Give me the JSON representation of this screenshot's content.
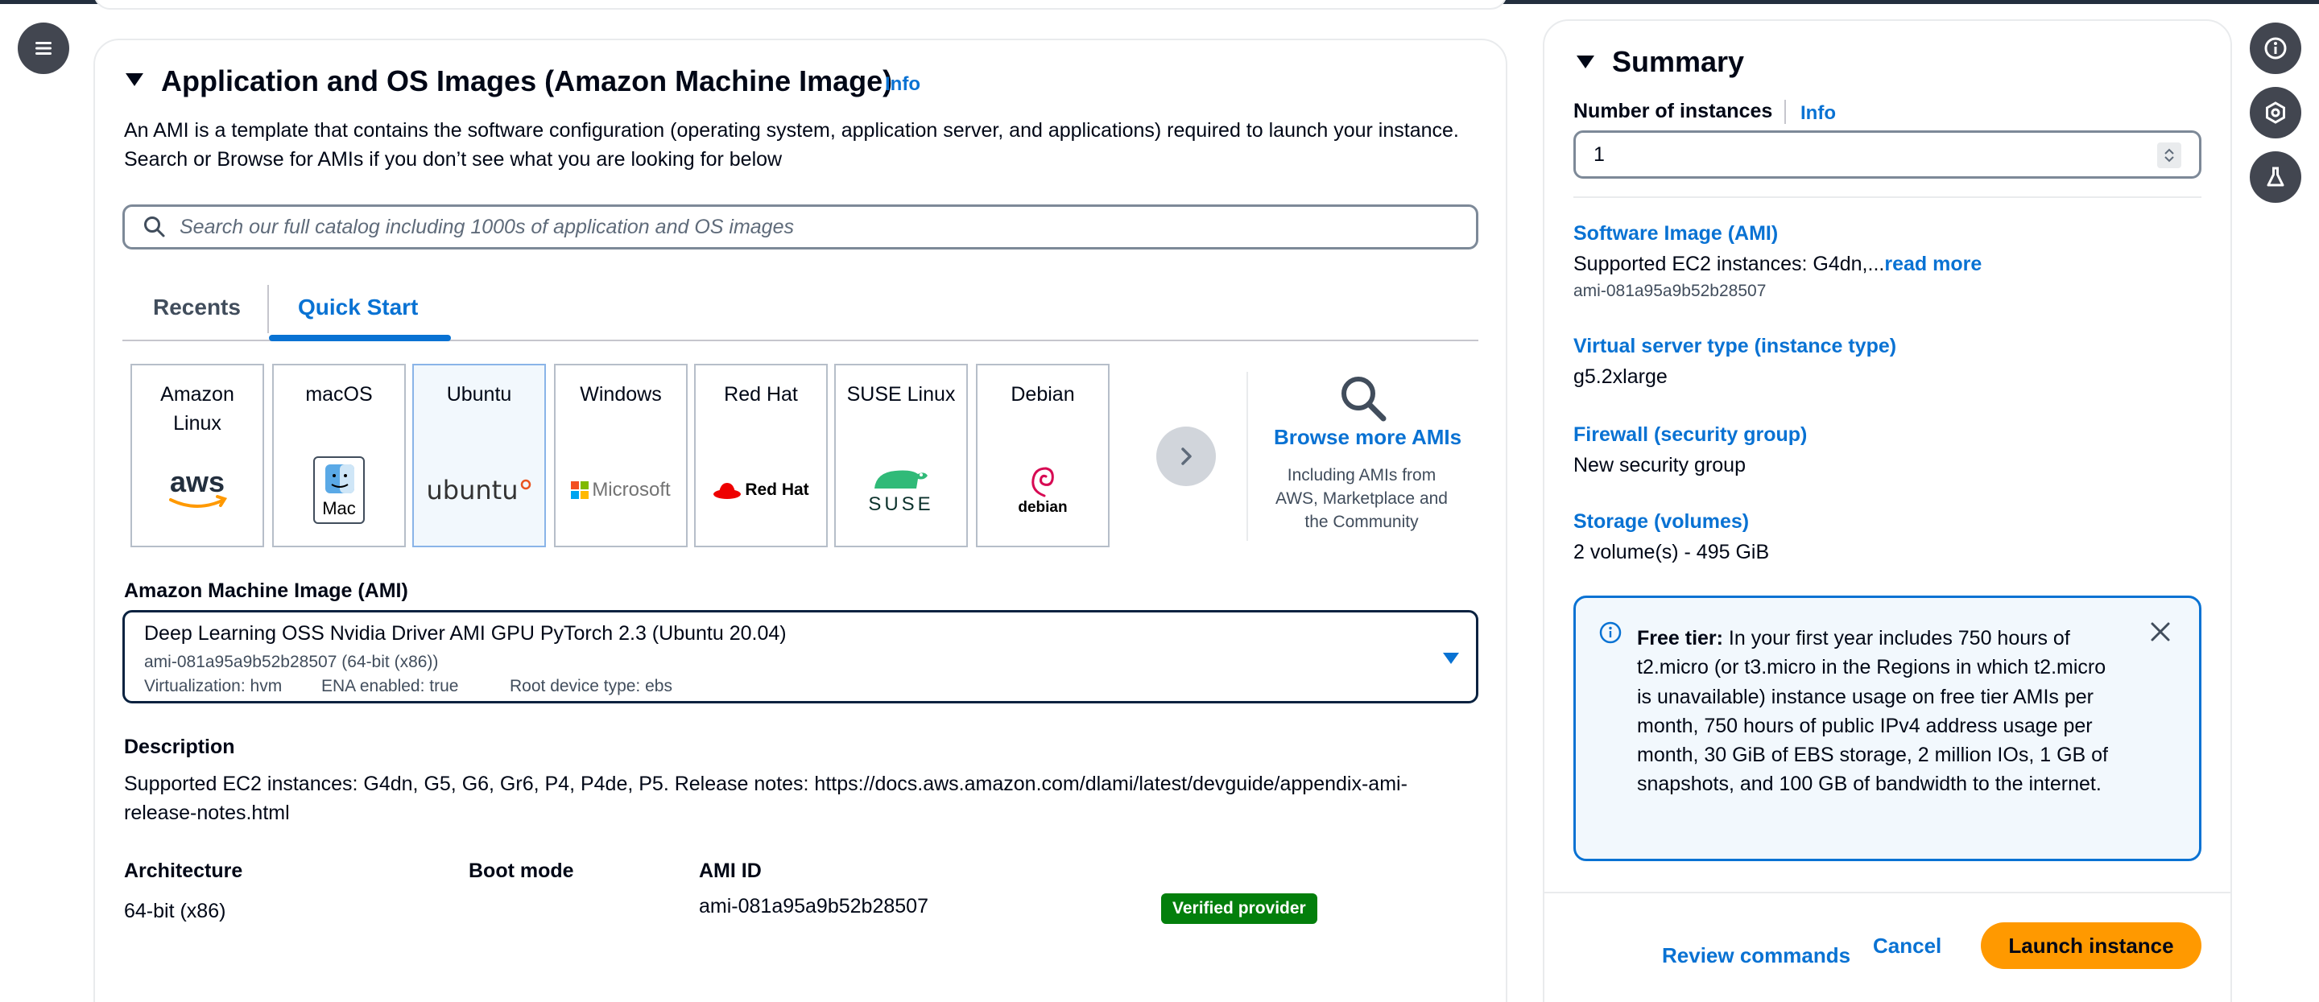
{
  "left_section": {
    "title": "Application and OS Images (Amazon Machine Image)",
    "info": "Info",
    "description": "An AMI is a template that contains the software configuration (operating system, application server, and applications) required to launch your instance. Search or Browse for AMIs if you don’t see what you are looking for below",
    "search_placeholder": "Search our full catalog including 1000s of application and OS images",
    "tabs": [
      {
        "label": "Recents",
        "active": false
      },
      {
        "label": "Quick Start",
        "active": true
      }
    ],
    "os_tiles": [
      {
        "name": "Amazon Linux",
        "logo": "aws-logo"
      },
      {
        "name": "macOS",
        "logo": "mac-finder-logo",
        "logo_text": "Mac"
      },
      {
        "name": "Ubuntu",
        "logo": "ubuntu-logo",
        "logo_text": "ubuntu",
        "selected": true
      },
      {
        "name": "Windows",
        "logo": "microsoft-logo",
        "logo_text": "Microsoft"
      },
      {
        "name": "Red Hat",
        "logo": "redhat-logo",
        "logo_text": "Red Hat"
      },
      {
        "name": "SUSE Linux",
        "logo": "suse-logo",
        "logo_text": "SUSE"
      },
      {
        "name": "Debian",
        "logo": "debian-logo",
        "logo_text": "debian"
      }
    ],
    "browse_more": {
      "label": "Browse more AMIs",
      "subtext": "Including AMIs from AWS, Marketplace and the Community"
    },
    "ami_label": "Amazon Machine Image (AMI)",
    "ami_selected": {
      "name": "Deep Learning OSS Nvidia Driver AMI GPU PyTorch 2.3 (Ubuntu 20.04)",
      "id_line": "ami-081a95a9b52b28507 (64-bit (x86))",
      "virtualization": "Virtualization: hvm",
      "ena": "ENA enabled: true",
      "root_device": "Root device type: ebs"
    },
    "description_label": "Description",
    "description_text": "Supported EC2 instances: G4dn, G5, G6, Gr6, P4, P4de, P5. Release notes: https://docs.aws.amazon.com/dlami/latest/devguide/appendix-ami-release-notes.html",
    "architecture_label": "Architecture",
    "architecture_value": "64-bit (x86)",
    "boot_mode_label": "Boot mode",
    "ami_id_label": "AMI ID",
    "ami_id_value": "ami-081a95a9b52b28507",
    "verified_badge": "Verified provider"
  },
  "summary": {
    "title": "Summary",
    "num_instances_label": "Number of instances",
    "info": "Info",
    "num_instances_value": "1",
    "software_image_label": "Software Image (AMI)",
    "software_image_value": "Supported EC2 instances: G4dn,...",
    "read_more": "read more",
    "software_image_id": "ami-081a95a9b52b28507",
    "instance_type_label": "Virtual server type (instance type)",
    "instance_type_value": "g5.2xlarge",
    "firewall_label": "Firewall (security group)",
    "firewall_value": "New security group",
    "storage_label": "Storage (volumes)",
    "storage_value": "2 volume(s) - 495 GiB",
    "free_tier_bold": "Free tier:",
    "free_tier_text": " In your first year includes 750 hours of t2.micro (or t3.micro in the Regions in which t2.micro is unavailable) instance usage on free tier AMIs per month, 750 hours of public IPv4 address usage per month, 30 GiB of EBS storage, 2 million IOs, 1 GB of snapshots, and 100 GB of bandwidth to the internet.",
    "review_commands": "Review commands",
    "cancel": "Cancel",
    "launch": "Launch instance"
  },
  "colors": {
    "link": "#0972d3",
    "launch": "#ff9900",
    "badge": "#037f0c",
    "dark_icon_bg": "#424650"
  }
}
